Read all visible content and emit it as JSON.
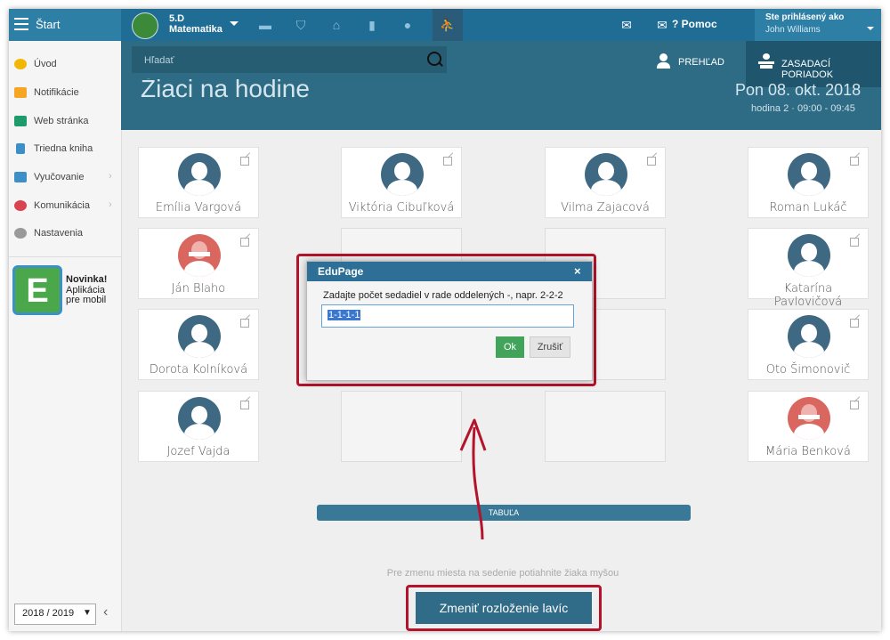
{
  "topbar": {
    "start_label": "Štart",
    "class_line1": "5.D",
    "class_line2": "Matematika",
    "help_label": "? Pomoc",
    "logged_in_label": "Ste prihlásený ako",
    "user_name": "John Williams"
  },
  "sidebar": {
    "items": [
      {
        "label": "Úvod",
        "icon": "star-icon",
        "color": "#f2b705"
      },
      {
        "label": "Notifikácie",
        "icon": "envelope-icon",
        "color": "#f5a623"
      },
      {
        "label": "Web stránka",
        "icon": "home-icon",
        "color": "#1e9b6a"
      },
      {
        "label": "Triedna kniha",
        "icon": "book-icon",
        "color": "#3d8fc8"
      },
      {
        "label": "Vyučovanie",
        "icon": "open-book-icon",
        "color": "#3d8fc8"
      },
      {
        "label": "Komunikácia",
        "icon": "chat-icon",
        "color": "#d9434f"
      },
      {
        "label": "Nastavenia",
        "icon": "gear-icon",
        "color": "#999999"
      }
    ],
    "promo_title": "Novinka!",
    "promo_line2": "Aplikácia",
    "promo_line3": "pre mobil",
    "promo_logo": "E",
    "year_value": "2018 / 2019"
  },
  "header": {
    "search_placeholder": "Hľadať",
    "title": "Žiaci na hodine",
    "prehlad_label": "PREHĽAD",
    "zasadaci_label": "ZASADACÍ PORIADOK",
    "date": "Pon 08. okt. 2018",
    "lesson": "hodina 2 · 09:00 - 09:45"
  },
  "seats": [
    {
      "name": "Emília Vargová",
      "gender": "m"
    },
    {
      "name": "Viktória Cibuľková",
      "gender": "m"
    },
    {
      "name": "Vilma Zajacová",
      "gender": "m"
    },
    {
      "name": "Roman Lukáč",
      "gender": "m"
    },
    {
      "name": "Ján Blaho",
      "gender": "f"
    },
    {
      "name": "Katarína Pavlovičová",
      "gender": "m"
    },
    {
      "name": "Dorota Kolníková",
      "gender": "m"
    },
    {
      "name": "Oto Šimonovič",
      "gender": "m"
    },
    {
      "name": "Jozef Vajda",
      "gender": "m"
    },
    {
      "name": "Mária Benková",
      "gender": "f"
    }
  ],
  "board_label": "TABUĽA",
  "hint": "Pre zmenu miesta na sedenie potiahnite žiaka myšou",
  "change_layout_button": "Zmeniť rozloženie lavíc",
  "dialog": {
    "title": "EduPage",
    "close": "×",
    "message": "Zadajte počet sedadiel v rade oddelených -, napr. 2-2-2",
    "input_value": "1-1-1-1",
    "ok_label": "Ok",
    "cancel_label": "Zrušiť"
  },
  "colors": {
    "annotation": "#b3132b",
    "header": "#2e6b84",
    "accent": "#1f6d95"
  }
}
